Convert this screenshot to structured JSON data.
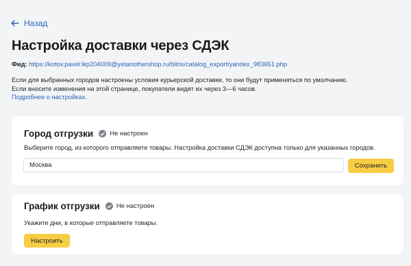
{
  "nav": {
    "back_label": "Назад"
  },
  "page": {
    "title": "Настройка доставки через СДЭК"
  },
  "feed": {
    "label": "Фид:",
    "url": "https://kotov.pavel:ikp204009@yetanothershop.ru/bitrix/catalog_export/yandex_983651.php"
  },
  "description": {
    "line1": "Если для выбранных городов настроены условия курьерской доставки, то они будут применяться по умолчанию.",
    "line2": "Если вносите изменения на этой странице, покупатели видят их через 3—6 часов.",
    "more_link": "Подробнее о настройках",
    "more_suffix": "."
  },
  "shipping_city": {
    "title": "Город отгрузки",
    "status": "Не настроен",
    "status_icon": "check-circle-icon",
    "hint": "Выберите город, из которого отправляете товары. Настройка доставки СДЭК доступна только для указанных городов.",
    "input_value": "Москва",
    "save_label": "Сохранить"
  },
  "shipping_schedule": {
    "title": "График отгрузки",
    "status": "Не настроен",
    "status_icon": "check-circle-icon",
    "hint": "Укажите дни, в которые отправляете товары.",
    "button_label": "Настроить"
  },
  "colors": {
    "link": "#2a63b8",
    "button": "#f7cd46",
    "background": "#f3f4f6",
    "status_icon": "#7d8089"
  }
}
